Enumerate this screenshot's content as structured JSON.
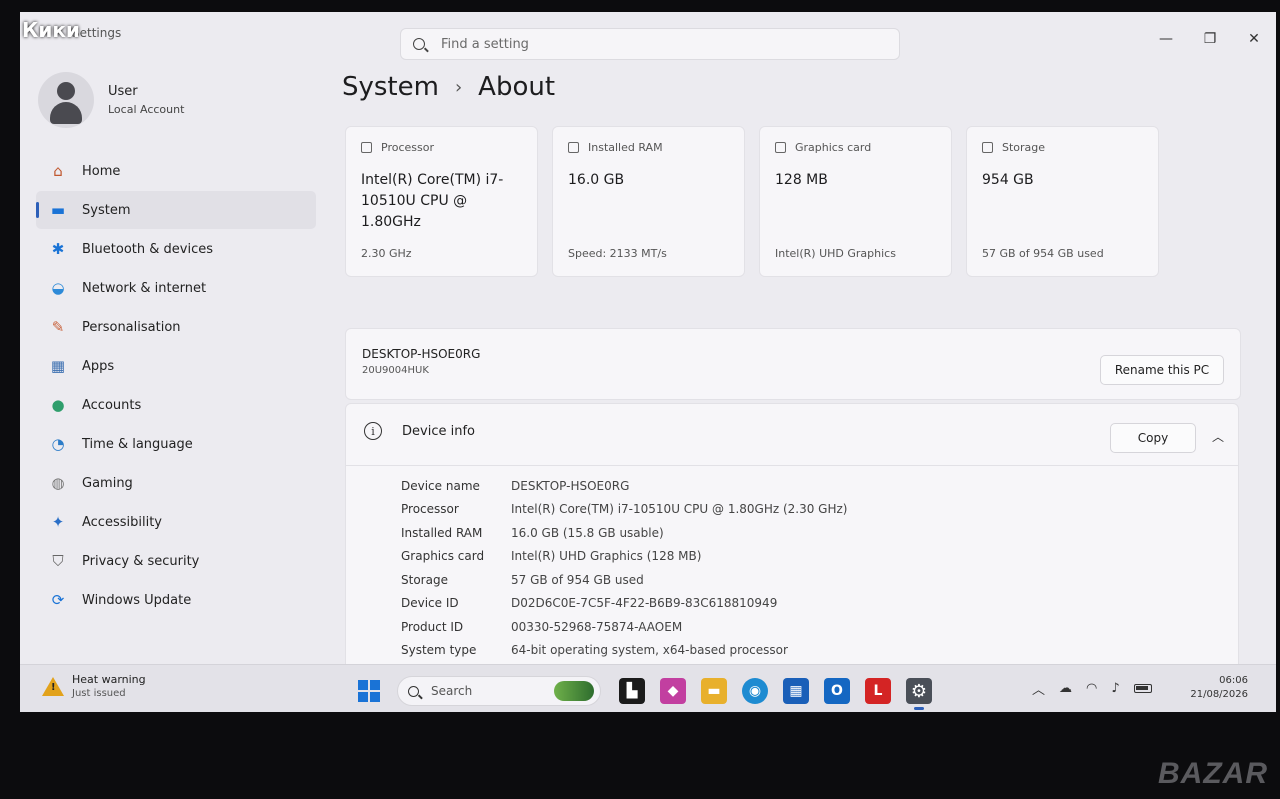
{
  "overlay_label": "Кики",
  "watermark": "BAZAR",
  "app": {
    "title": "Settings"
  },
  "search": {
    "placeholder": "Find a setting"
  },
  "window_controls": {
    "minimize": "—",
    "maximize": "❐",
    "close": "✕"
  },
  "user": {
    "name": "User",
    "account": "Local Account"
  },
  "nav": [
    {
      "label": "Home",
      "icon": "home-icon",
      "color": "#c0572f"
    },
    {
      "label": "System",
      "icon": "monitor-icon",
      "color": "#1a73d6",
      "active": true
    },
    {
      "label": "Bluetooth & devices",
      "icon": "bluetooth-icon",
      "color": "#1a73d6"
    },
    {
      "label": "Network & internet",
      "icon": "wifi-icon",
      "color": "#2d8ad8"
    },
    {
      "label": "Personalisation",
      "icon": "brush-icon",
      "color": "#c8623c"
    },
    {
      "label": "Apps",
      "icon": "apps-icon",
      "color": "#3c6fb0"
    },
    {
      "label": "Accounts",
      "icon": "person-icon",
      "color": "#2f9e6c"
    },
    {
      "label": "Time & language",
      "icon": "globe-clock-icon",
      "color": "#2c7cc8"
    },
    {
      "label": "Gaming",
      "icon": "gamepad-icon",
      "color": "#777777"
    },
    {
      "label": "Accessibility",
      "icon": "accessibility-icon",
      "color": "#2a6fc7"
    },
    {
      "label": "Privacy & security",
      "icon": "shield-icon",
      "color": "#666666"
    },
    {
      "label": "Windows Update",
      "icon": "update-icon",
      "color": "#1a73d6"
    }
  ],
  "breadcrumb": {
    "parent": "System",
    "separator": "›",
    "current": "About"
  },
  "cards": [
    {
      "title": "Processor",
      "value": "Intel(R) Core(TM) i7-10510U CPU @ 1.80GHz",
      "footer": "2.30 GHz"
    },
    {
      "title": "Installed RAM",
      "value": "16.0 GB",
      "footer": "Speed: 2133 MT/s"
    },
    {
      "title": "Graphics card",
      "value": "128 MB",
      "footer": "Intel(R) UHD Graphics"
    },
    {
      "title": "Storage",
      "value": "954 GB",
      "footer": "57 GB of 954 GB used"
    }
  ],
  "pc": {
    "name": "DESKTOP-HSOE0RG",
    "model": "20U9004HUK",
    "rename_label": "Rename this PC"
  },
  "device_info": {
    "title": "Device info",
    "copy_label": "Copy",
    "rows": [
      {
        "key": "Device name",
        "value": "DESKTOP-HSOE0RG"
      },
      {
        "key": "Processor",
        "value": "Intel(R) Core(TM) i7-10510U CPU @ 1.80GHz (2.30 GHz)"
      },
      {
        "key": "Installed RAM",
        "value": "16.0 GB (15.8 GB usable)"
      },
      {
        "key": "Graphics card",
        "value": "Intel(R) UHD Graphics (128 MB)"
      },
      {
        "key": "Storage",
        "value": "57 GB of 954 GB used"
      },
      {
        "key": "Device ID",
        "value": "D02D6C0E-7C5F-4F22-B6B9-83C618810949"
      },
      {
        "key": "Product ID",
        "value": "00330-52968-75874-AAOEM"
      },
      {
        "key": "System type",
        "value": "64-bit operating system, x64-based processor"
      }
    ]
  },
  "taskbar": {
    "notice_title": "Heat warning",
    "notice_sub": "Just issued",
    "search_label": "Search",
    "apps": [
      {
        "icon": "terminal-icon",
        "glyph": "▙",
        "color": "#1b1b1b"
      },
      {
        "icon": "m365-icon",
        "glyph": "◆",
        "color": "#c23fa0"
      },
      {
        "icon": "file-explorer-icon",
        "glyph": "▬",
        "color": "#e8b02c"
      },
      {
        "icon": "edge-icon",
        "glyph": "◉",
        "color": "#1e8bd1"
      },
      {
        "icon": "store-icon",
        "glyph": "▦",
        "color": "#1a5fb8"
      },
      {
        "icon": "outlook-icon",
        "glyph": "O",
        "color": "#1467c2"
      },
      {
        "icon": "l-app-icon",
        "glyph": "L",
        "color": "#d42424"
      },
      {
        "icon": "settings-gear-icon",
        "glyph": "⚙",
        "color": "#4a4f58"
      }
    ],
    "time": "06:06",
    "date": "21/08/2026"
  }
}
